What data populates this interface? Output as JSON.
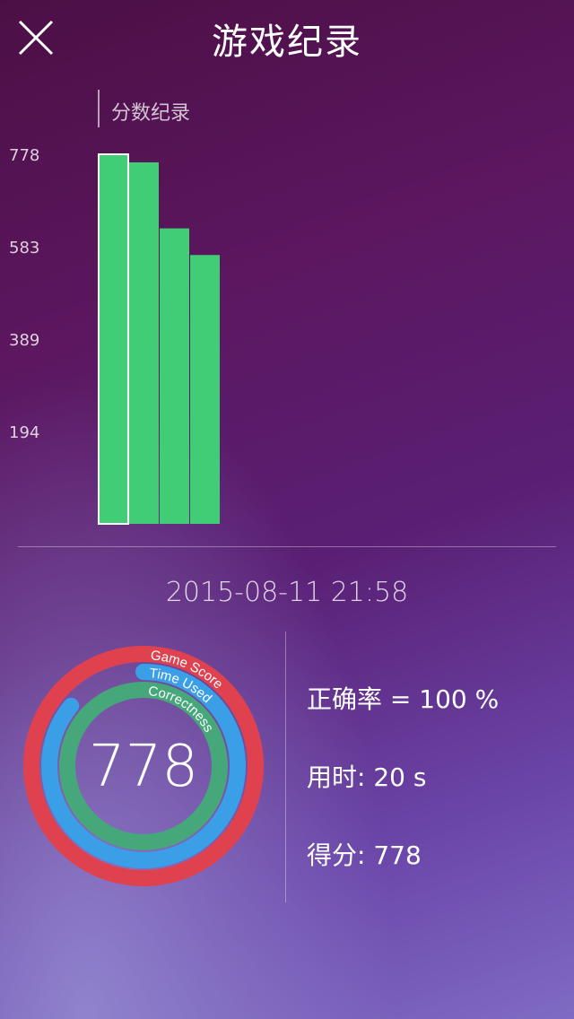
{
  "header": {
    "title": "游戏纪录",
    "close_icon": "close-icon"
  },
  "chart_data": {
    "type": "bar",
    "title": "分数纪录",
    "values": [
      778,
      761,
      622,
      566
    ],
    "selected_index": 0,
    "yticks": [
      194,
      389,
      583,
      778
    ],
    "ylim": [
      0,
      778
    ],
    "color": "#41cc76",
    "grid": false
  },
  "record": {
    "datetime": "2015-08-11   21:58",
    "score_display": "778",
    "rings": [
      {
        "label": "Game Score",
        "color": "#e0414f",
        "fraction": 1.0
      },
      {
        "label": "Time Used",
        "color": "#3a9fe6",
        "fraction": 0.86
      },
      {
        "label": "Correctness",
        "color": "#46a87a",
        "fraction": 1.0
      }
    ],
    "stats": {
      "accuracy": "正确率 = 100 %",
      "time_used": "用时: 20 s",
      "score": "得分: 778"
    }
  }
}
